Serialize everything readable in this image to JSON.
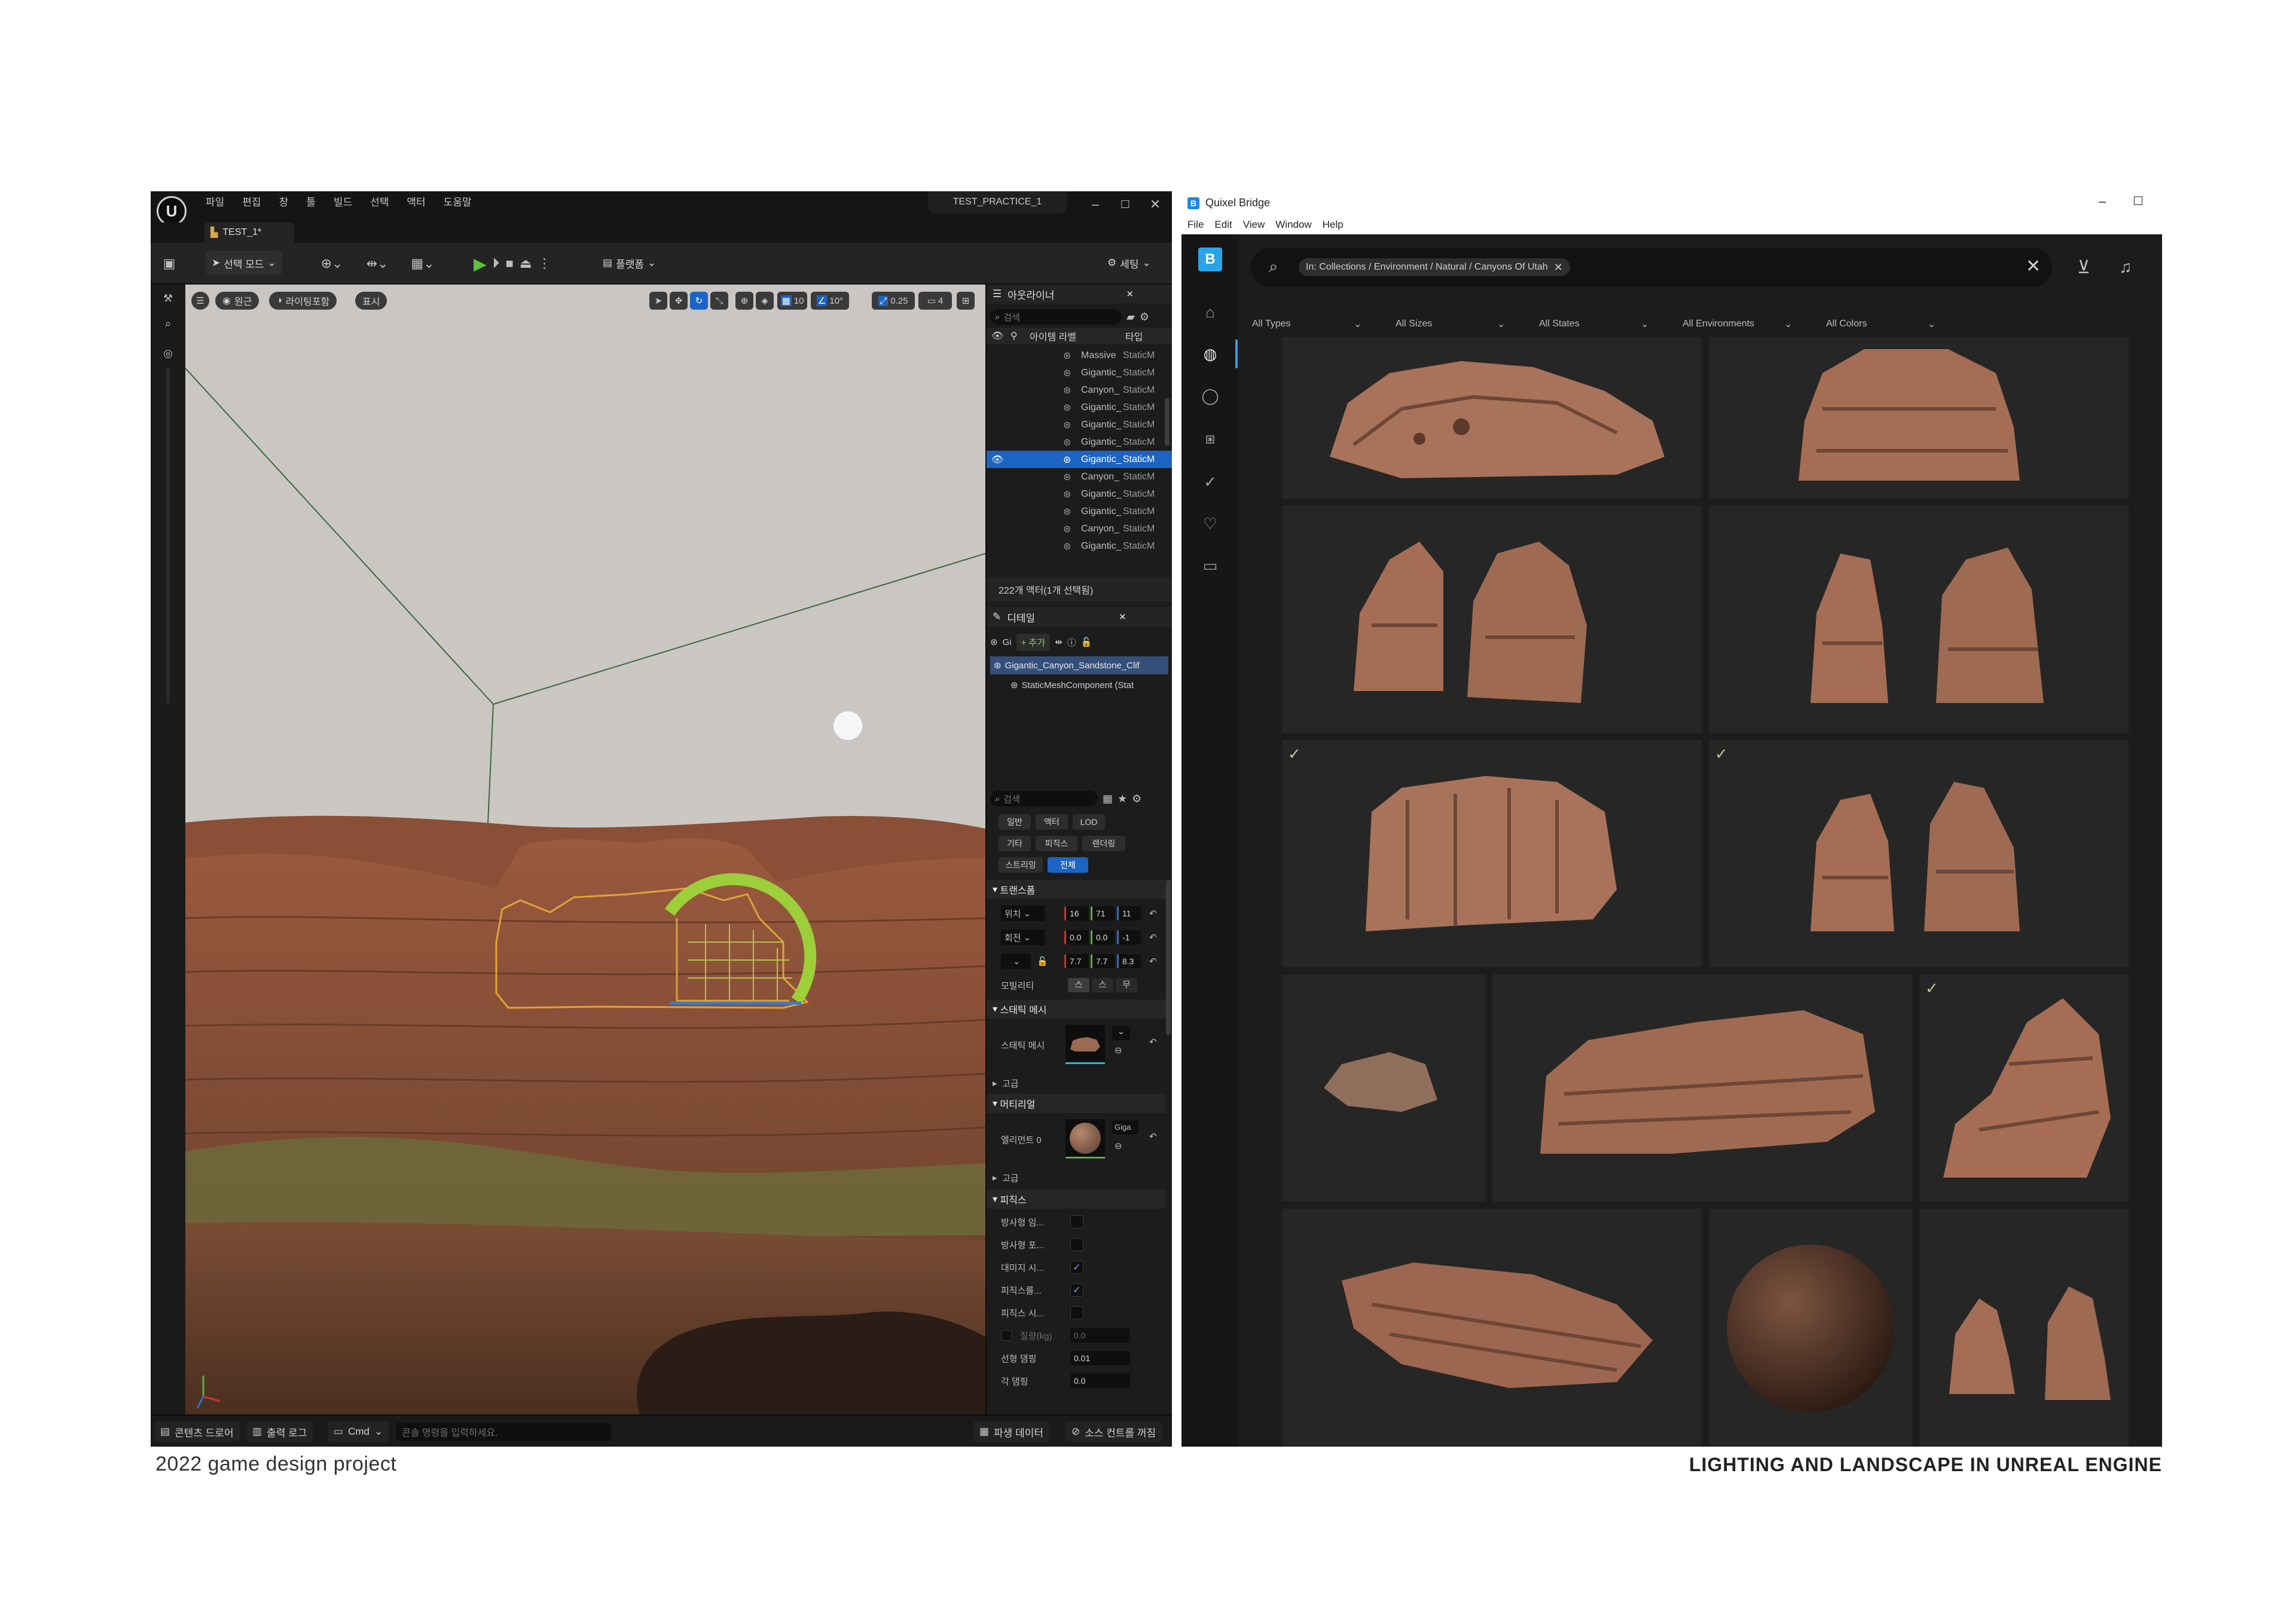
{
  "ue": {
    "menu": [
      "파일",
      "편집",
      "창",
      "툴",
      "빌드",
      "선택",
      "액터",
      "도움말"
    ],
    "project_title": "TEST_PRACTICE_1",
    "level_tab": "TEST_1*",
    "toolbar": {
      "select_mode": "선택 모드",
      "platforms": "플랫폼",
      "settings": "세팅"
    },
    "viewport": {
      "perspective": "원근",
      "lit": "라이팅포함",
      "show": "표시",
      "grid_snap": "10",
      "rot_snap": "10°",
      "scale_snap": "0.25",
      "cam_speed": "4"
    },
    "outliner": {
      "tab": "아웃라이너",
      "search_placeholder": "검색",
      "col_label": "아이템 라벨",
      "col_type": "타입",
      "rows": [
        {
          "label": "Massive",
          "type": "StaticM"
        },
        {
          "label": "Gigantic_",
          "type": "StaticM"
        },
        {
          "label": "Canyon_",
          "type": "StaticM"
        },
        {
          "label": "Gigantic_",
          "type": "StaticM"
        },
        {
          "label": "Gigantic_",
          "type": "StaticM"
        },
        {
          "label": "Gigantic_",
          "type": "StaticM"
        },
        {
          "label": "Gigantic_",
          "type": "StaticM"
        },
        {
          "label": "Canyon_",
          "type": "StaticM"
        },
        {
          "label": "Gigantic_",
          "type": "StaticM"
        },
        {
          "label": "Gigantic_",
          "type": "StaticM"
        },
        {
          "label": "Canyon_",
          "type": "StaticM"
        },
        {
          "label": "Gigantic_",
          "type": "StaticM"
        }
      ],
      "status": "222개 액터(1개 선택됨)"
    },
    "details": {
      "tab": "디테일",
      "actor_short": "Gi",
      "add": "+ 추가",
      "component_root": "Gigantic_Canyon_Sandstone_Clif",
      "component_child": "StaticMeshComponent (Stat",
      "search_placeholder": "검색",
      "filter_tabs": [
        "일반",
        "액터",
        "LOD",
        "기타",
        "피직스",
        "렌더링",
        "스트리밍",
        "전체"
      ],
      "sections": {
        "transform": "트랜스폼",
        "static_mesh": "스태틱 메시",
        "advanced": "고급",
        "materials": "머티리얼",
        "physics": "피직스"
      },
      "labels": {
        "location": "위치",
        "rotation": "회전",
        "mobility": "모빌리티",
        "static_mesh": "스태틱 메시",
        "element0": "엘리먼트 0"
      },
      "location": [
        "16",
        "71",
        "11"
      ],
      "rotation": [
        "0.0",
        "0.0",
        "-1"
      ],
      "scale": [
        "7.7",
        "7.7",
        "8.3"
      ],
      "mobility_opts": [
        "스",
        "스",
        "무"
      ],
      "material_name": "Giga",
      "physics_rows": [
        {
          "label": "방사형 임...",
          "checked": false
        },
        {
          "label": "방사형 포...",
          "checked": false
        },
        {
          "label": "대미지 시...",
          "checked": true
        },
        {
          "label": "피직스를...",
          "checked": true
        },
        {
          "label": "피직스 시...",
          "checked": false
        }
      ],
      "mass_label": "질량(kg)",
      "mass_value": "0.0",
      "linear_damping_label": "선형 댐핑",
      "linear_damping": "0.01",
      "angular_damping_label": "각 댐핑",
      "angular_damping": "0.0"
    },
    "status_bar": {
      "content_drawer": "콘텐츠 드로어",
      "output_log": "출력 로그",
      "cmd": "Cmd",
      "console_placeholder": "콘솔 명령을 입력하세요.",
      "derived_data": "파생 데이터",
      "source_control": "소스 컨트롤 꺼짐"
    }
  },
  "bridge": {
    "app_title": "Quixel Bridge",
    "menu": [
      "File",
      "Edit",
      "View",
      "Window",
      "Help"
    ],
    "breadcrumb_chip": "In: Collections / Environment / Natural / Canyons Of Utah",
    "filters": [
      "All Types",
      "All Sizes",
      "All States",
      "All Environments",
      "All Colors"
    ],
    "sidebar_icons": [
      "home-icon",
      "globe-icon",
      "user-icon",
      "gift-icon",
      "check-circle-icon",
      "heart-icon",
      "monitor-icon"
    ],
    "tiles": [
      {
        "checked": false
      },
      {
        "checked": false
      },
      {
        "checked": false
      },
      {
        "checked": false
      },
      {
        "checked": true
      },
      {
        "checked": true
      },
      {
        "checked": false
      },
      {
        "checked": false
      },
      {
        "checked": true
      },
      {
        "checked": false
      },
      {
        "checked": false
      },
      {
        "checked": false
      }
    ]
  },
  "captions": {
    "left": "2022 game design project",
    "right": "LIGHTING AND LANDSCAPE IN UNREAL ENGINE"
  }
}
